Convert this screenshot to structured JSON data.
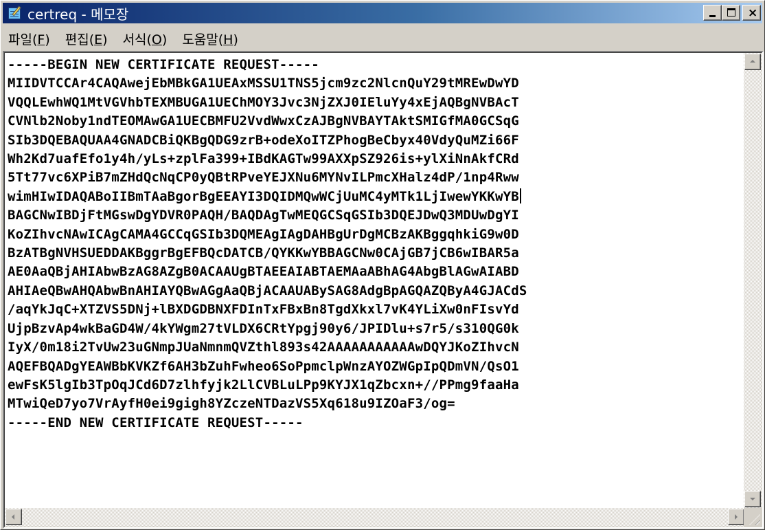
{
  "window": {
    "title": "certreq - 메모장",
    "icon": "notepad-icon",
    "title_bar_color": "#0a246a"
  },
  "menu": [
    {
      "label": "파일(",
      "key": "F",
      "tail": ")"
    },
    {
      "label": "편집(",
      "key": "E",
      "tail": ")"
    },
    {
      "label": "서식(",
      "key": "O",
      "tail": ")"
    },
    {
      "label": "도움말(",
      "key": "H",
      "tail": ")"
    }
  ],
  "document": {
    "lines": [
      "-----BEGIN NEW CERTIFICATE REQUEST-----",
      "MIIDVTCCAr4CAQAwejEbMBkGA1UEAxMSSU1TNS5jcm9zc2NlcnQuY29tMREwDwYD",
      "VQQLEwhWQ1MtVGVhbTEXMBUGA1UEChMOY3Jvc3NjZXJ0IEluYy4xEjAQBgNVBAcT",
      "CVNlb2Noby1ndTEOMAwGA1UECBMFU2VvdWwxCzAJBgNVBAYTAktSMIGfMA0GCSqG",
      "SIb3DQEBAQUAA4GNADCBiQKBgQDG9zrB+odeXoITZPhogBeCbyx40VdyQuMZi66F",
      "Wh2Kd7uafEfo1y4h/yLs+zplFa399+IBdKAGTw99AXXpSZ926is+ylXiNnAkfCRd",
      "5Tt77vc6XPiB7mZHdQcNqCP0yQBtRPveYEJXNu6MYNvILPmcXHalz4dP/1np4Rww",
      "wimHIwIDAQABoIIBmTAaBgorBgEEAYI3DQIDMQwWCjUuMC4yMTk1LjIwewYKKwYB",
      "BAGCNwIBDjFtMGswDgYDVR0PAQH/BAQDAgTwMEQGCSqGSIb3DQEJDwQ3MDUwDgYI",
      "KoZIhvcNAwICAgCAMA4GCCqGSIb3DQMEAgIAgDAHBgUrDgMCBzAKBggqhkiG9w0D",
      "BzATBgNVHSUEDDAKBggrBgEFBQcDATCB/QYKKwYBBAGCNw0CAjGB7jCB6wIBAR5a",
      "AE0AaQBjAHIAbwBzAG8AZgB0ACAAUgBTAEEAIABTAEMAaABhAG4AbgBlAGwAIABD",
      "AHIAeQBwAHQAbwBnAHIAYQBwAGgAaQBjACAAUABySAG8AdgBpAGQAZQByA4GJACdS",
      "/aqYkJqC+XTZVS5DNj+lBXDGDBNXFDInTxFBxBn8TgdXkxl7vK4YLiXw0nFIsvYd",
      "UjpBzvAp4wkBaGD4W/4kYWgm27tVLDX6CRtYpgj90y6/JPIDlu+s7r5/s310QG0k",
      "IyX/0m18i2TvUw23uGNmpJUaNmnmQVZthl893s42AAAAAAAAAAAwDQYJKoZIhvcN",
      "AQEFBQADgYEAWBbKVKZf6AH3bZuhFwheo6SoPpmclpWnzAYOZWGpIpQDmVN/QsO1",
      "ewFsK5lgIb3TpOqJCd6D7zlhfyjk2LlCVBLuLPp9KYJX1qZbcxn+//PPmg9faaHa",
      "MTwiQeD7yo7VrAyfH0ei9gigh8YZczeNTDazVS5Xq618u9IZOaF3/og=",
      "-----END NEW CERTIFICATE REQUEST-----"
    ],
    "caret_line": 7
  },
  "scrollbars": {
    "vertical_icons": [
      "scroll-up-icon",
      "scroll-down-icon"
    ],
    "horizontal_icons": [
      "scroll-left-icon",
      "scroll-right-icon"
    ]
  }
}
